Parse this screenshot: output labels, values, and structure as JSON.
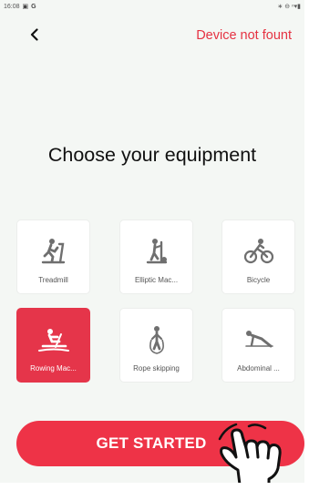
{
  "statusbar": {
    "time": "16:08",
    "glyphs": [
      "▣",
      "G"
    ],
    "right_icons": "∗ ⊖ ⁿ▾▮"
  },
  "header": {
    "back_icon": "chevron-left-icon",
    "device_status": "Device not fount",
    "status_color": "#e53242"
  },
  "title": "Choose your equipment",
  "equipment": [
    {
      "label": "Treadmill",
      "icon": "treadmill-icon",
      "selected": false
    },
    {
      "label": "Elliptic Mac...",
      "icon": "elliptic-machine-icon",
      "selected": false
    },
    {
      "label": "Bicycle",
      "icon": "bicycle-icon",
      "selected": false
    },
    {
      "label": "Rowing Mac...",
      "icon": "rowing-machine-icon",
      "selected": true
    },
    {
      "label": "Rope skipping",
      "icon": "rope-skipping-icon",
      "selected": false
    },
    {
      "label": "Abdominal ...",
      "icon": "abdominal-icon",
      "selected": false
    }
  ],
  "cta": {
    "label": "GET STARTED",
    "color": "#ee3347"
  },
  "colors": {
    "accent": "#e5354a",
    "background": "#f4f7f4",
    "icon_gray": "#6f6f6f"
  }
}
